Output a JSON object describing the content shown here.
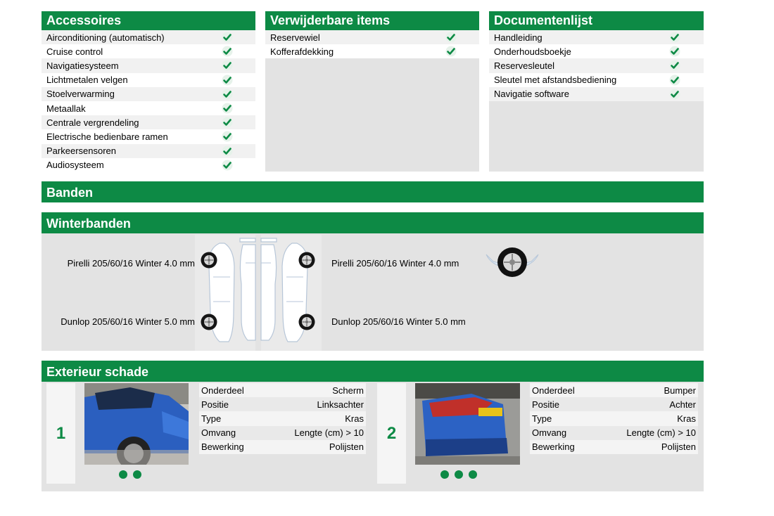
{
  "accessoires": {
    "title": "Accessoires",
    "items": [
      "Airconditioning (automatisch)",
      "Cruise control",
      "Navigatiesysteem",
      "Lichtmetalen velgen",
      "Stoelverwarming",
      "Metaallak",
      "Centrale vergrendeling",
      "Electrische bedienbare ramen",
      "Parkeersensoren",
      "Audiosysteem"
    ]
  },
  "verwijderbare": {
    "title": "Verwijderbare items",
    "items": [
      "Reservewiel",
      "Kofferafdekking"
    ]
  },
  "documenten": {
    "title": "Documentenlijst",
    "items": [
      "Handleiding",
      "Onderhoudsboekje",
      "Reservesleutel",
      "Sleutel met afstandsbediening",
      "Navigatie software"
    ]
  },
  "banden": {
    "title": "Banden"
  },
  "winterbanden": {
    "title": "Winterbanden",
    "front_left": "Pirelli 205/60/16  Winter 4.0 mm",
    "rear_left": "Dunlop 205/60/16  Winter 5.0 mm",
    "front_right": "Pirelli 205/60/16  Winter 4.0 mm",
    "rear_right": "Dunlop 205/60/16  Winter 5.0 mm"
  },
  "exterieur": {
    "title": "Exterieur schade",
    "damages": [
      {
        "number": "1",
        "rows": [
          {
            "label": "Onderdeel",
            "value": "Scherm"
          },
          {
            "label": "Positie",
            "value": "Linksachter"
          },
          {
            "label": "Type",
            "value": "Kras"
          },
          {
            "label": "Omvang",
            "value": "Lengte (cm) > 10"
          },
          {
            "label": "Bewerking",
            "value": "Polijsten"
          }
        ],
        "photo_count": 2
      },
      {
        "number": "2",
        "rows": [
          {
            "label": "Onderdeel",
            "value": "Bumper"
          },
          {
            "label": "Positie",
            "value": "Achter"
          },
          {
            "label": "Type",
            "value": "Kras"
          },
          {
            "label": "Omvang",
            "value": "Lengte (cm) > 10"
          },
          {
            "label": "Bewerking",
            "value": "Polijsten"
          }
        ],
        "photo_count": 3
      }
    ]
  },
  "colors": {
    "accent": "#0d8a45",
    "panel_bg": "#e3e3e3"
  },
  "icons": {
    "check": "check-icon",
    "wheel": "wheel-icon"
  }
}
